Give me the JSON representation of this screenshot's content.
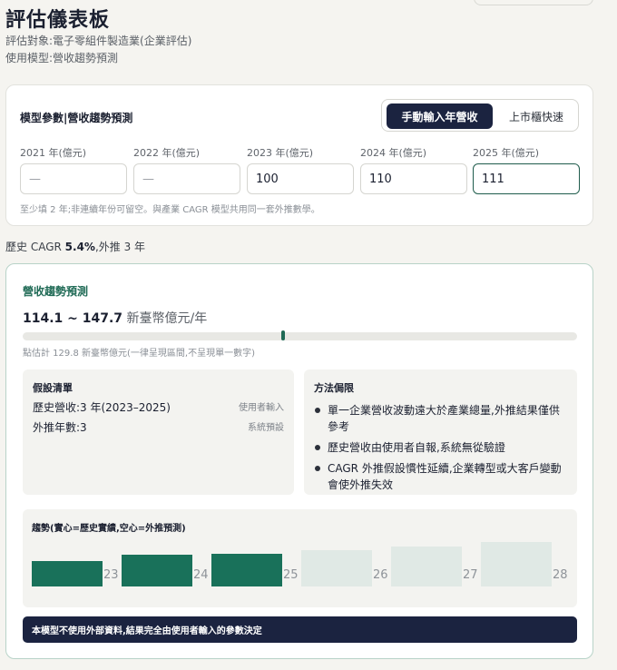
{
  "header": {
    "title": "評估儀表板",
    "subject_line": "評估對象:電子零組件製造業(企業評估)",
    "model_line": "使用模型:營收趨勢預測"
  },
  "params": {
    "title": "模型參數|營收趨勢預測",
    "mode_manual": "手動輸入年營收",
    "mode_listed": "上市櫃快速",
    "years": [
      {
        "label": "2021 年(億元)",
        "value": "",
        "placeholder": "—"
      },
      {
        "label": "2022 年(億元)",
        "value": "",
        "placeholder": "—"
      },
      {
        "label": "2023 年(億元)",
        "value": "100",
        "placeholder": "—"
      },
      {
        "label": "2024 年(億元)",
        "value": "110",
        "placeholder": "—"
      },
      {
        "label": "2025 年(億元)",
        "value": "111",
        "placeholder": "—"
      }
    ],
    "hint": "至少填 2 年;非連續年份可留空。與產業 CAGR 模型共用同一套外推數學。"
  },
  "cagr": {
    "prefix": "歷史 CAGR ",
    "value": "5.4%",
    "suffix": ",外推 3 年"
  },
  "forecast": {
    "title": "營收趨勢預測",
    "range_value": "114.1 ~ 147.7",
    "range_unit": " 新臺幣億元/年",
    "marker_fraction": 0.47,
    "note": "點估計 129.8 新臺幣億元(一律呈現區間,不呈現單一數字)",
    "assumptions": {
      "title": "假設清單",
      "items": [
        {
          "label": "歷史營收:3 年(2023–2025)",
          "source": "使用者輸入"
        },
        {
          "label": "外推年數:3",
          "source": "系統預設"
        }
      ]
    },
    "limits": {
      "title": "方法侷限",
      "items": [
        "單一企業營收波動遠大於產業總量,外推結果僅供參考",
        "歷史營收由使用者自報,系統無從驗證",
        "CAGR 外推假設慣性延續,企業轉型或大客戶變動會使外推失效"
      ]
    },
    "trend": {
      "title": "趨勢(實心=歷史實績,空心=外推預測)"
    },
    "footer": "本模型不使用外部資料,結果完全由使用者輸入的參數決定"
  },
  "colors": {
    "accent": "#1f6a55",
    "navy": "#1b2340",
    "historical_bar": "#19715a",
    "projected_bar": "#e0e9e5"
  },
  "chart_data": {
    "type": "bar",
    "categories": [
      "23",
      "24",
      "25",
      "26",
      "27",
      "28"
    ],
    "values": [
      100,
      110,
      111,
      117,
      123,
      130
    ],
    "kinds": [
      "historical",
      "historical",
      "historical",
      "projected",
      "projected",
      "projected"
    ],
    "title": "趨勢(實心=歷史實績,空心=外推預測)"
  }
}
